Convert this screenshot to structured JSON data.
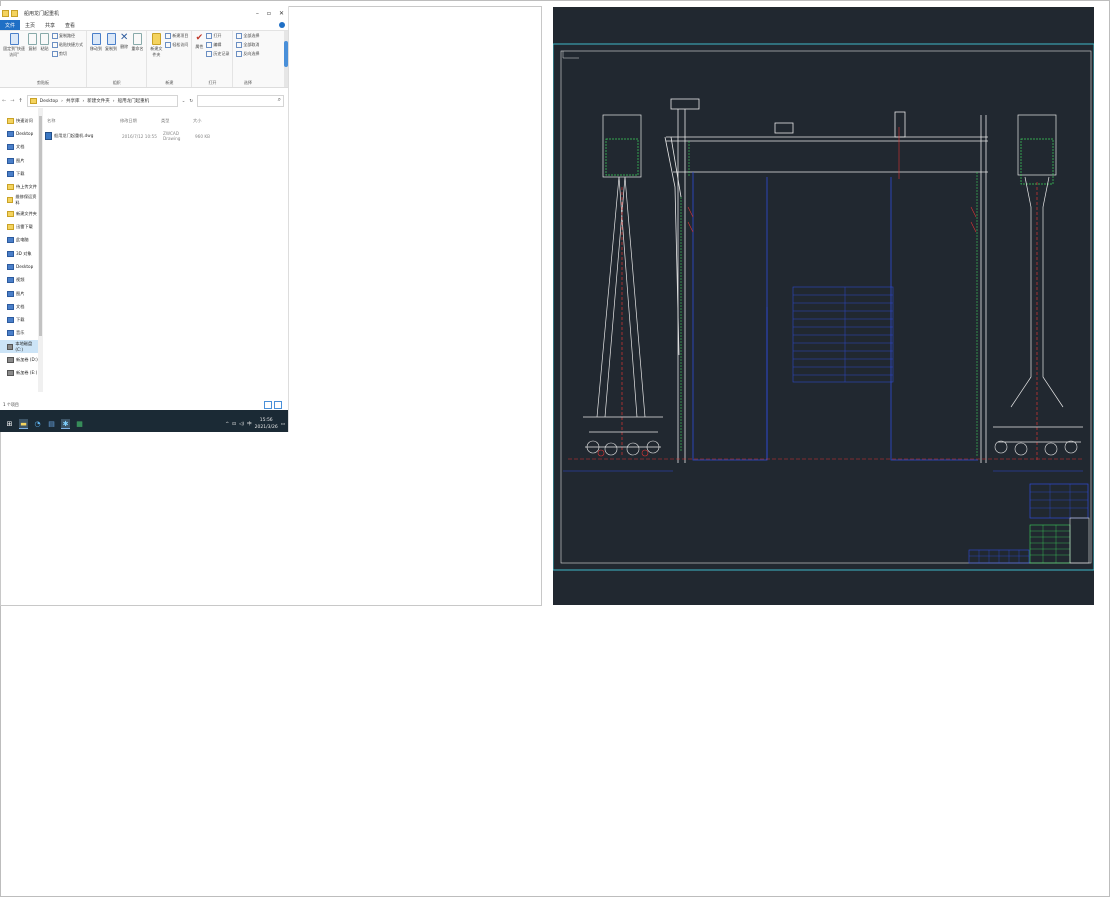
{
  "explorer": {
    "window_title": "船用龙门起重机",
    "tabs": [
      "文件",
      "主页",
      "共享",
      "查看"
    ],
    "ribbon": {
      "clipboard": {
        "label": "剪贴板",
        "pin_label": "固定到\"快速访问\"",
        "copy_label": "复制",
        "paste_label": "粘贴",
        "copy_path": "复制路径",
        "paste_shortcut": "粘贴快捷方式",
        "cut": "剪切"
      },
      "organize": {
        "label": "组织",
        "move_to": "移动到",
        "copy_to": "复制到",
        "delete": "删除",
        "rename": "重命名"
      },
      "new": {
        "label": "新建",
        "new_folder": "新建文件夹",
        "new_item": "新建项目",
        "easy_access": "轻松访问"
      },
      "open": {
        "label": "打开",
        "properties": "属性",
        "open": "打开",
        "edit": "编辑",
        "history": "历史记录"
      },
      "select": {
        "label": "选择",
        "select_all": "全部选择",
        "select_none": "全部取消",
        "invert": "反向选择"
      }
    },
    "breadcrumb": [
      "Desktop",
      "共享库",
      "新建文件夹",
      "船用龙门起重机"
    ],
    "nav_items": [
      {
        "label": "快速访问",
        "icon": "star-icon"
      },
      {
        "label": "Desktop",
        "icon": "desktop-icon"
      },
      {
        "label": "文档",
        "icon": "document-icon"
      },
      {
        "label": "图片",
        "icon": "picture-icon"
      },
      {
        "label": "下载",
        "icon": "download-icon"
      },
      {
        "label": "待上传文件",
        "icon": "folder-icon"
      },
      {
        "label": "维修保运资料",
        "icon": "folder-icon"
      },
      {
        "label": "新建文件夹",
        "icon": "folder-icon"
      },
      {
        "label": "迅雷下载",
        "icon": "folder-icon"
      },
      {
        "label": "此电脑",
        "icon": "computer-icon"
      },
      {
        "label": "3D 对象",
        "icon": "cube-icon"
      },
      {
        "label": "Desktop",
        "icon": "desktop-icon"
      },
      {
        "label": "视频",
        "icon": "video-icon"
      },
      {
        "label": "图片",
        "icon": "picture-icon"
      },
      {
        "label": "文档",
        "icon": "document-icon"
      },
      {
        "label": "下载",
        "icon": "download-icon"
      },
      {
        "label": "音乐",
        "icon": "music-icon"
      },
      {
        "label": "本地磁盘 (C:)",
        "icon": "drive-icon"
      },
      {
        "label": "新加卷 (D:)",
        "icon": "drive-icon"
      },
      {
        "label": "新加卷 (E:)",
        "icon": "drive-icon"
      }
    ],
    "columns": [
      "名称",
      "修改日期",
      "类型",
      "大小"
    ],
    "files": [
      {
        "name": "船用龙门起重机.dwg",
        "modified": "2016/7/12 10:55",
        "type": "ZWCAD Drawing",
        "size": "960 KB"
      }
    ],
    "status": "1 个项目",
    "taskbar": {
      "time": "15:56",
      "date": "2021/3/26"
    }
  },
  "colors": {
    "cad_background": "#212830",
    "taskbar": "#1b2a35",
    "accent": "#1f6fc5"
  }
}
